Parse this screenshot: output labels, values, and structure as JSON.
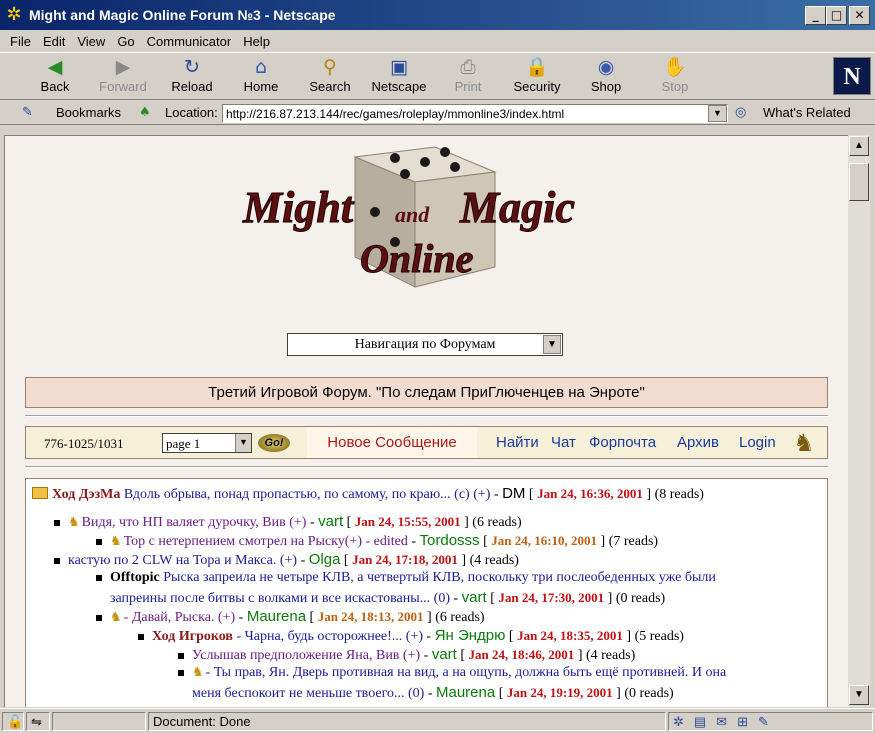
{
  "window": {
    "title": "Might and Magic Online Forum №3 - Netscape"
  },
  "menu": [
    "File",
    "Edit",
    "View",
    "Go",
    "Communicator",
    "Help"
  ],
  "toolbar": {
    "buttons": [
      {
        "label": "Back",
        "icon": "back-icon",
        "enabled": true
      },
      {
        "label": "Forward",
        "icon": "forward-icon",
        "enabled": false
      },
      {
        "label": "Reload",
        "icon": "reload-icon",
        "enabled": true
      },
      {
        "label": "Home",
        "icon": "home-icon",
        "enabled": true
      },
      {
        "label": "Search",
        "icon": "search-icon",
        "enabled": true
      },
      {
        "label": "Netscape",
        "icon": "netscape-icon",
        "enabled": true
      },
      {
        "label": "Print",
        "icon": "print-icon",
        "enabled": false
      },
      {
        "label": "Security",
        "icon": "security-icon",
        "enabled": true
      },
      {
        "label": "Shop",
        "icon": "shop-icon",
        "enabled": true
      },
      {
        "label": "Stop",
        "icon": "stop-icon",
        "enabled": false
      }
    ]
  },
  "location": {
    "bookmarks_label": "Bookmarks",
    "location_label": "Location:",
    "url": "http://216.87.213.144/rec/games/roleplay/mmonline3/index.html",
    "whats_related": "What's Related"
  },
  "page": {
    "nav_select": "Навигация по Форумам",
    "forum_title": "Третий Игровой Форум. \"По следам ПриГлюченцев на Энроте\"",
    "count": "776-1025/1031",
    "page_select": "page 1",
    "go_label": "Go!",
    "new_message": "Новое Сообщение",
    "links": [
      "Найти",
      "Чат",
      "Форпочта",
      "Архив",
      "Login"
    ]
  },
  "threads": [
    {
      "title": "Ход ДэзМа",
      "text": "Вдоль обрыва, понад пропастью, по самому, по краю... (с) (+)",
      "author": "DM",
      "date": "Jan 24, 16:36, 2001",
      "reads": "(8 reads)"
    },
    {
      "text": "Видя, что НП валяет дурочку, Вив (+)",
      "author": "vart",
      "date": "Jan 24, 15:55, 2001",
      "reads": "(6 reads)"
    },
    {
      "text": "Тор с нетерпением смотрел на Рыску(+) - edited",
      "author": "Tordosss",
      "date": "Jan 24, 16:10, 2001",
      "reads": "(7 reads)"
    },
    {
      "text": "кастую по 2 CLW на Тора и Макса. (+)",
      "author": "Olga",
      "date": "Jan 24, 17:18, 2001",
      "reads": "(4 reads)"
    },
    {
      "title": "Offtopic",
      "text1": "Рыска запреила не четыре КЛВ, а четвертый КЛВ, поскольку три послеобеденных уже были",
      "text2": "запреины после битвы с волками и все искастованы... (0)",
      "author": "vart",
      "date": "Jan 24, 17:30, 2001",
      "reads": "(0 reads)"
    },
    {
      "text": "- Давай, Рыска. (+)",
      "author": "Maurena",
      "date": "Jan 24, 18:13, 2001",
      "reads": "(6 reads)"
    },
    {
      "title": "Ход Игроков",
      "text": "- Чарна, будь осторожнее!... (+)",
      "author": "Ян Эндрю",
      "date": "Jan 24, 18:35, 2001",
      "reads": "(5 reads)"
    },
    {
      "text": "Услышав предположение Яна, Вив (+)",
      "author": "vart",
      "date": "Jan 24, 18:46, 2001",
      "reads": "(4 reads)"
    },
    {
      "text1": "- Ты прав, Ян. Дверь противная на вид, а на ощупь, должна быть ещё противней. И она",
      "text2": "меня беспокоит не меньше твоего... (0)",
      "author": "Maurena",
      "date": "Jan 24, 19:19, 2001",
      "reads": "(0 reads)"
    }
  ],
  "status": {
    "text": "Document: Done"
  },
  "logo": {
    "line1": "Might",
    "and": "and",
    "line2": "Magic",
    "line3": "Online"
  }
}
